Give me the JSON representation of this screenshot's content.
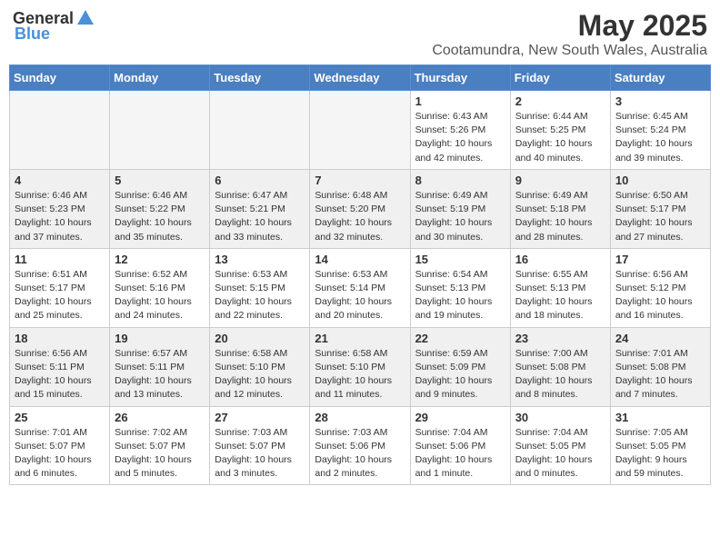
{
  "header": {
    "logo_general": "General",
    "logo_blue": "Blue",
    "month": "May 2025",
    "location": "Cootamundra, New South Wales, Australia"
  },
  "weekdays": [
    "Sunday",
    "Monday",
    "Tuesday",
    "Wednesday",
    "Thursday",
    "Friday",
    "Saturday"
  ],
  "weeks": [
    [
      {
        "day": "",
        "info": ""
      },
      {
        "day": "",
        "info": ""
      },
      {
        "day": "",
        "info": ""
      },
      {
        "day": "",
        "info": ""
      },
      {
        "day": "1",
        "info": "Sunrise: 6:43 AM\nSunset: 5:26 PM\nDaylight: 10 hours\nand 42 minutes."
      },
      {
        "day": "2",
        "info": "Sunrise: 6:44 AM\nSunset: 5:25 PM\nDaylight: 10 hours\nand 40 minutes."
      },
      {
        "day": "3",
        "info": "Sunrise: 6:45 AM\nSunset: 5:24 PM\nDaylight: 10 hours\nand 39 minutes."
      }
    ],
    [
      {
        "day": "4",
        "info": "Sunrise: 6:46 AM\nSunset: 5:23 PM\nDaylight: 10 hours\nand 37 minutes."
      },
      {
        "day": "5",
        "info": "Sunrise: 6:46 AM\nSunset: 5:22 PM\nDaylight: 10 hours\nand 35 minutes."
      },
      {
        "day": "6",
        "info": "Sunrise: 6:47 AM\nSunset: 5:21 PM\nDaylight: 10 hours\nand 33 minutes."
      },
      {
        "day": "7",
        "info": "Sunrise: 6:48 AM\nSunset: 5:20 PM\nDaylight: 10 hours\nand 32 minutes."
      },
      {
        "day": "8",
        "info": "Sunrise: 6:49 AM\nSunset: 5:19 PM\nDaylight: 10 hours\nand 30 minutes."
      },
      {
        "day": "9",
        "info": "Sunrise: 6:49 AM\nSunset: 5:18 PM\nDaylight: 10 hours\nand 28 minutes."
      },
      {
        "day": "10",
        "info": "Sunrise: 6:50 AM\nSunset: 5:17 PM\nDaylight: 10 hours\nand 27 minutes."
      }
    ],
    [
      {
        "day": "11",
        "info": "Sunrise: 6:51 AM\nSunset: 5:17 PM\nDaylight: 10 hours\nand 25 minutes."
      },
      {
        "day": "12",
        "info": "Sunrise: 6:52 AM\nSunset: 5:16 PM\nDaylight: 10 hours\nand 24 minutes."
      },
      {
        "day": "13",
        "info": "Sunrise: 6:53 AM\nSunset: 5:15 PM\nDaylight: 10 hours\nand 22 minutes."
      },
      {
        "day": "14",
        "info": "Sunrise: 6:53 AM\nSunset: 5:14 PM\nDaylight: 10 hours\nand 20 minutes."
      },
      {
        "day": "15",
        "info": "Sunrise: 6:54 AM\nSunset: 5:13 PM\nDaylight: 10 hours\nand 19 minutes."
      },
      {
        "day": "16",
        "info": "Sunrise: 6:55 AM\nSunset: 5:13 PM\nDaylight: 10 hours\nand 18 minutes."
      },
      {
        "day": "17",
        "info": "Sunrise: 6:56 AM\nSunset: 5:12 PM\nDaylight: 10 hours\nand 16 minutes."
      }
    ],
    [
      {
        "day": "18",
        "info": "Sunrise: 6:56 AM\nSunset: 5:11 PM\nDaylight: 10 hours\nand 15 minutes."
      },
      {
        "day": "19",
        "info": "Sunrise: 6:57 AM\nSunset: 5:11 PM\nDaylight: 10 hours\nand 13 minutes."
      },
      {
        "day": "20",
        "info": "Sunrise: 6:58 AM\nSunset: 5:10 PM\nDaylight: 10 hours\nand 12 minutes."
      },
      {
        "day": "21",
        "info": "Sunrise: 6:58 AM\nSunset: 5:10 PM\nDaylight: 10 hours\nand 11 minutes."
      },
      {
        "day": "22",
        "info": "Sunrise: 6:59 AM\nSunset: 5:09 PM\nDaylight: 10 hours\nand 9 minutes."
      },
      {
        "day": "23",
        "info": "Sunrise: 7:00 AM\nSunset: 5:08 PM\nDaylight: 10 hours\nand 8 minutes."
      },
      {
        "day": "24",
        "info": "Sunrise: 7:01 AM\nSunset: 5:08 PM\nDaylight: 10 hours\nand 7 minutes."
      }
    ],
    [
      {
        "day": "25",
        "info": "Sunrise: 7:01 AM\nSunset: 5:07 PM\nDaylight: 10 hours\nand 6 minutes."
      },
      {
        "day": "26",
        "info": "Sunrise: 7:02 AM\nSunset: 5:07 PM\nDaylight: 10 hours\nand 5 minutes."
      },
      {
        "day": "27",
        "info": "Sunrise: 7:03 AM\nSunset: 5:07 PM\nDaylight: 10 hours\nand 3 minutes."
      },
      {
        "day": "28",
        "info": "Sunrise: 7:03 AM\nSunset: 5:06 PM\nDaylight: 10 hours\nand 2 minutes."
      },
      {
        "day": "29",
        "info": "Sunrise: 7:04 AM\nSunset: 5:06 PM\nDaylight: 10 hours\nand 1 minute."
      },
      {
        "day": "30",
        "info": "Sunrise: 7:04 AM\nSunset: 5:05 PM\nDaylight: 10 hours\nand 0 minutes."
      },
      {
        "day": "31",
        "info": "Sunrise: 7:05 AM\nSunset: 5:05 PM\nDaylight: 9 hours\nand 59 minutes."
      }
    ]
  ]
}
